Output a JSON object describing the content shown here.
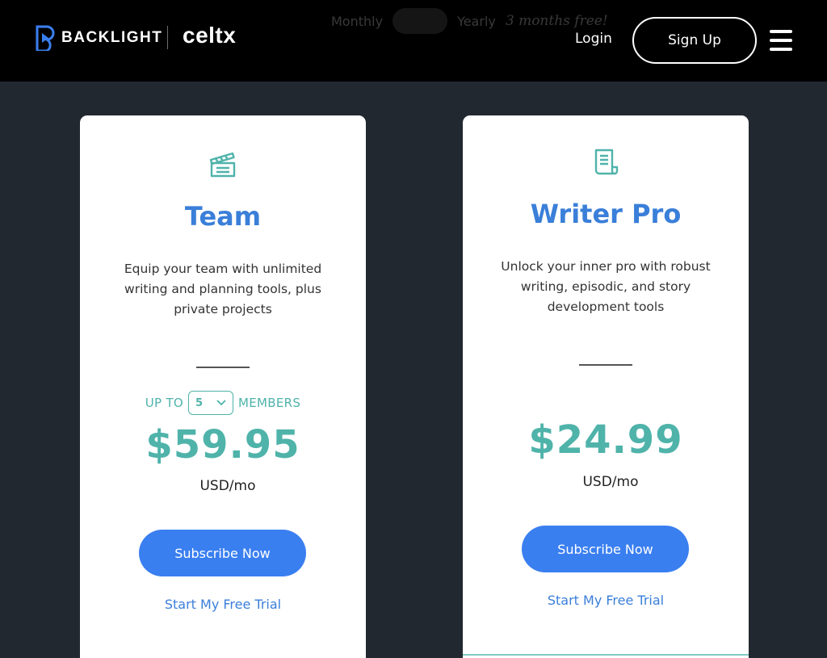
{
  "header": {
    "brand_primary": "BACKLIGHT",
    "brand_secondary": "celtx",
    "billing": {
      "monthly_label": "Monthly",
      "yearly_label": "Yearly",
      "promo_text": "3 months free!"
    },
    "login_label": "Login",
    "signup_label": "Sign Up",
    "menu_icon": "hamburger-icon"
  },
  "plans": [
    {
      "icon": "clapperboard-icon",
      "name": "Team",
      "description": "Equip your team with unlimited writing and planning tools, plus private projects",
      "members_prefix": "UP TO",
      "members_count": "5",
      "members_suffix": "MEMBERS",
      "price": "$59.95",
      "unit": "USD/mo",
      "subscribe_label": "Subscribe Now",
      "trial_label": "Start My Free Trial"
    },
    {
      "icon": "document-icon",
      "name": "Writer Pro",
      "description": "Unlock your inner pro with robust writing, episodic, and story development tools",
      "price": "$24.99",
      "unit": "USD/mo",
      "subscribe_label": "Subscribe Now",
      "trial_label": "Start My Free Trial"
    }
  ],
  "colors": {
    "background": "#212830",
    "header": "#000000",
    "title_blue": "#3a7fd9",
    "price_teal": "#4fb3aa",
    "button_blue": "#3a7ff0"
  }
}
